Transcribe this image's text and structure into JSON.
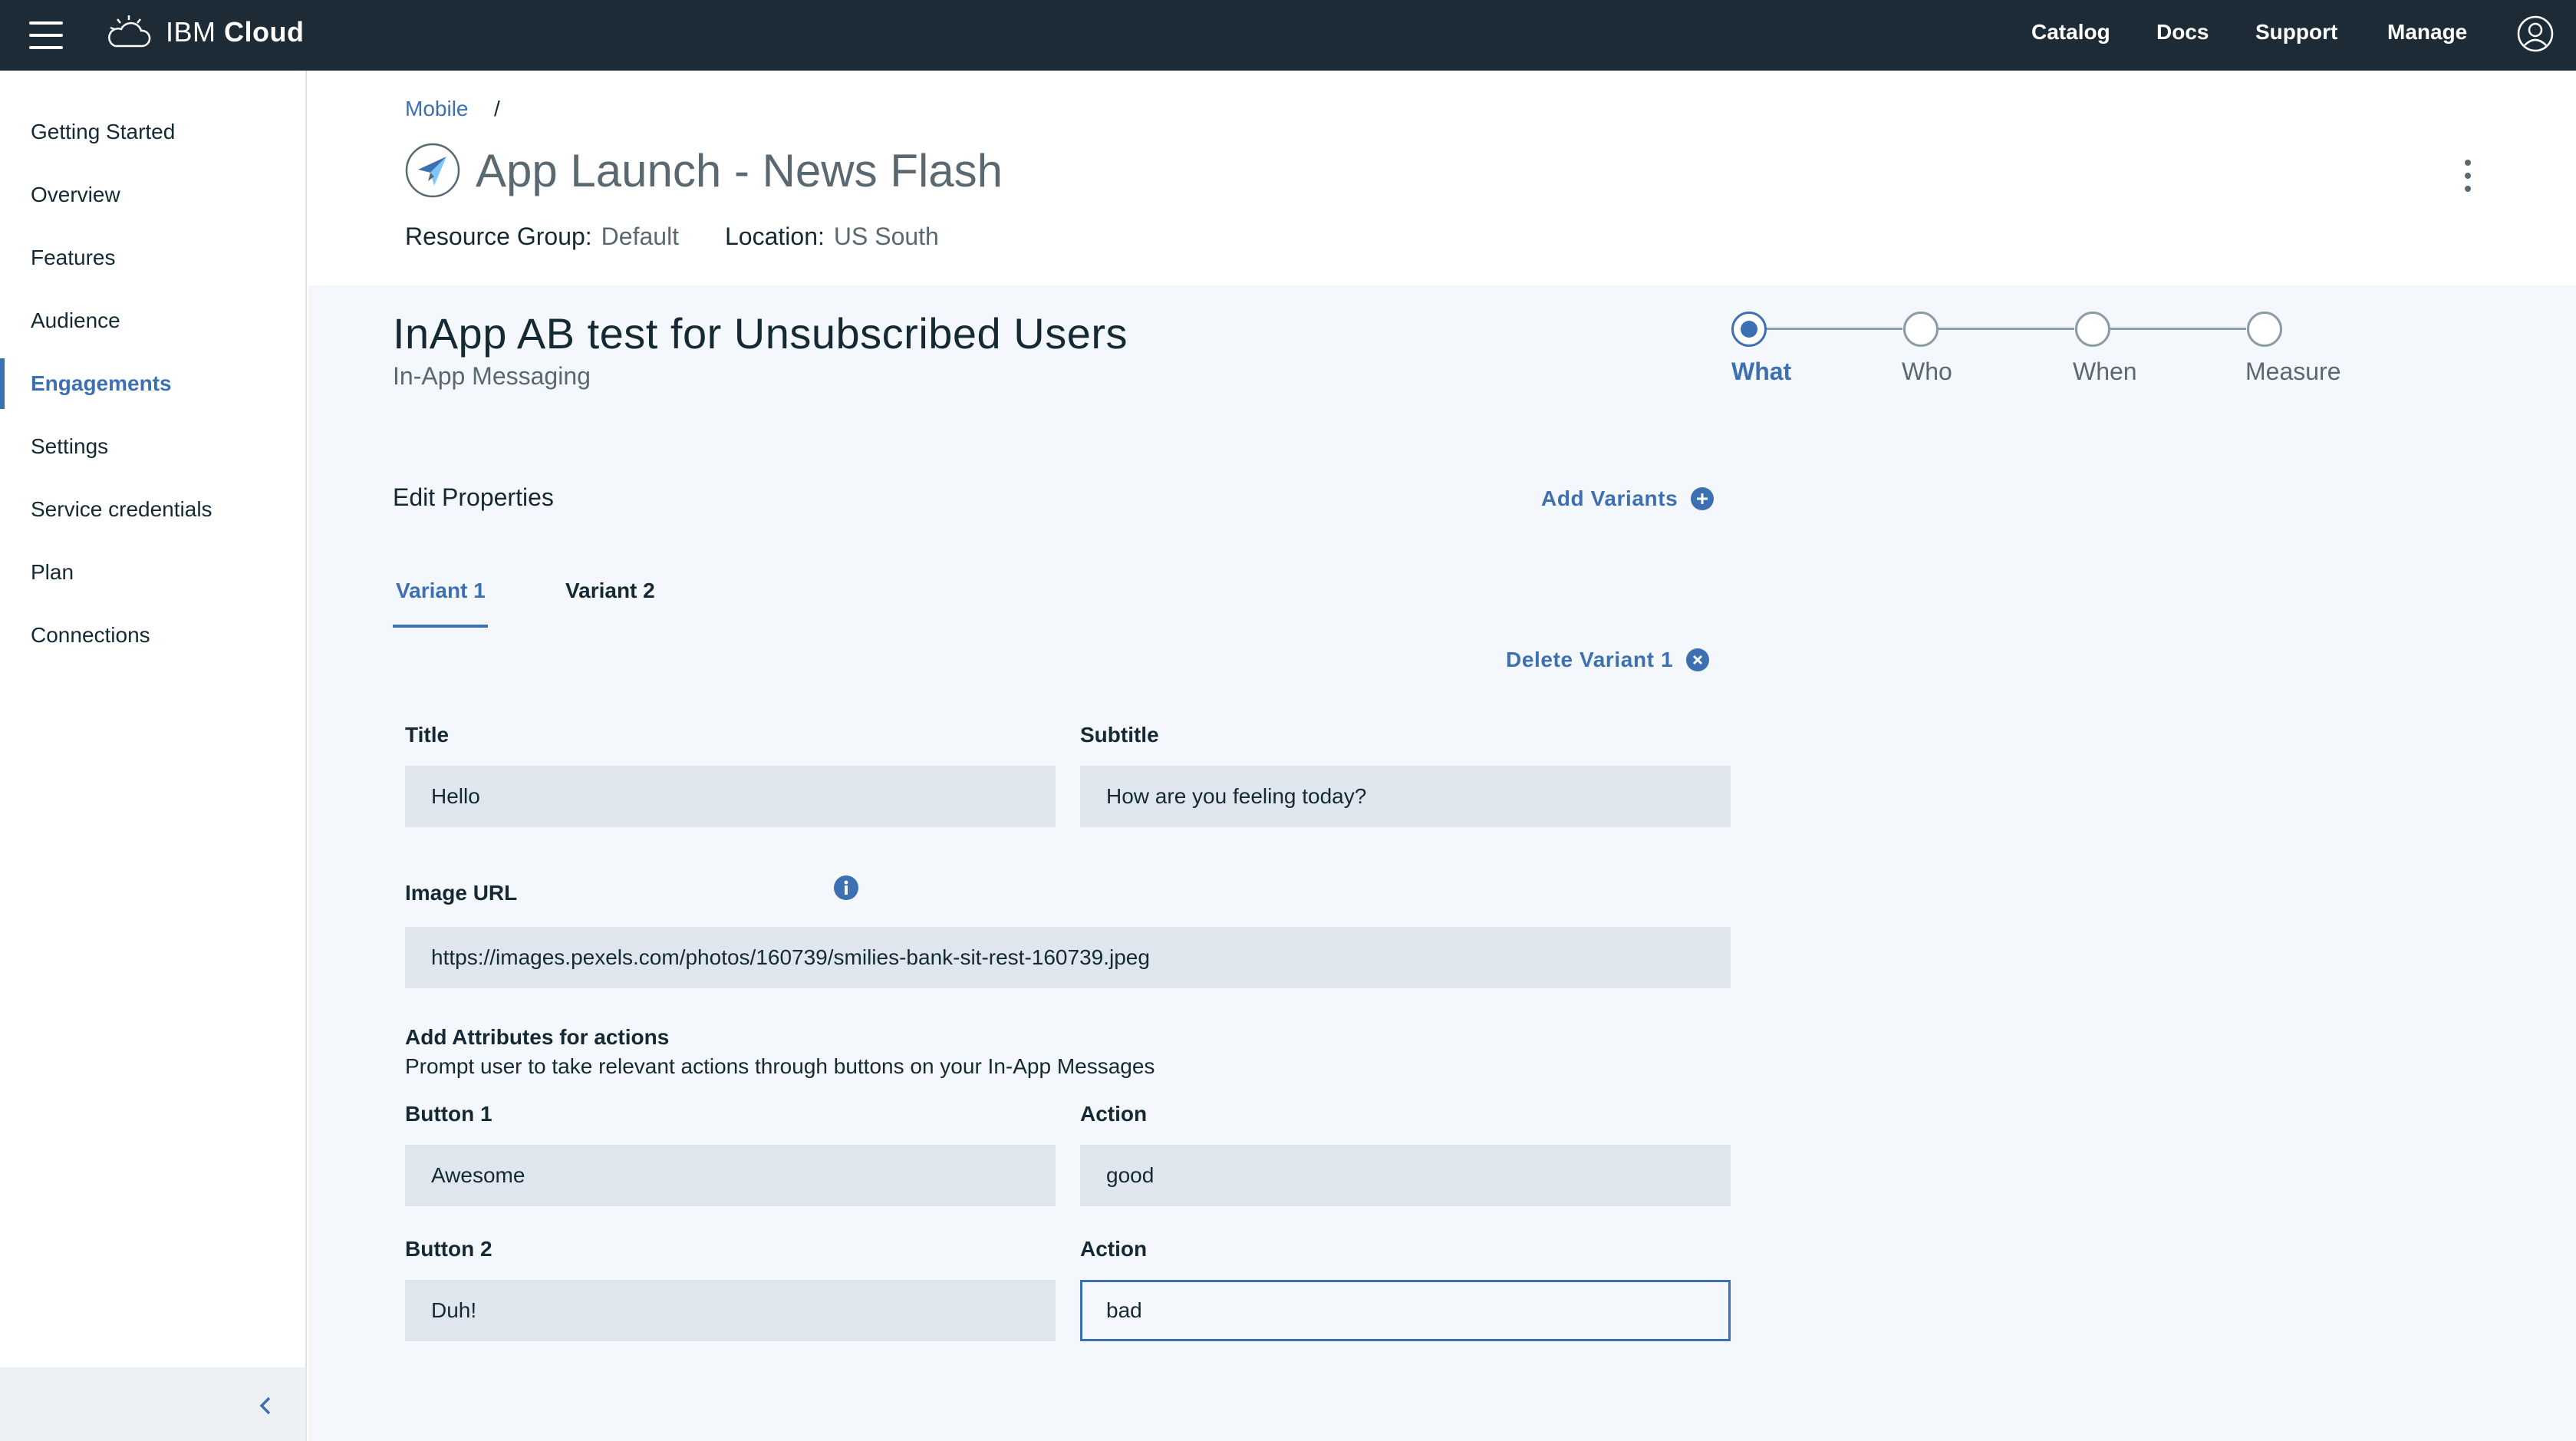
{
  "topbar": {
    "brand_prefix": "IBM",
    "brand_name": "Cloud",
    "nav": [
      "Catalog",
      "Docs",
      "Support",
      "Manage"
    ]
  },
  "sidebar": {
    "items": [
      {
        "label": "Getting Started"
      },
      {
        "label": "Overview"
      },
      {
        "label": "Features"
      },
      {
        "label": "Audience"
      },
      {
        "label": "Engagements",
        "active": true
      },
      {
        "label": "Settings"
      },
      {
        "label": "Service credentials"
      },
      {
        "label": "Plan"
      },
      {
        "label": "Connections"
      }
    ]
  },
  "header": {
    "breadcrumb": "Mobile",
    "breadcrumb_sep": "/",
    "title": "App Launch - News Flash",
    "resource_group_label": "Resource Group:",
    "resource_group_value": "Default",
    "location_label": "Location:",
    "location_value": "US South"
  },
  "engagement": {
    "title": "InApp AB test for Unsubscribed Users",
    "subtitle": "In-App Messaging",
    "steps": [
      {
        "label": "What",
        "active": true
      },
      {
        "label": "Who"
      },
      {
        "label": "When"
      },
      {
        "label": "Measure"
      }
    ],
    "edit_properties": "Edit Properties",
    "add_variants": "Add Variants",
    "tabs": [
      {
        "label": "Variant 1",
        "active": true
      },
      {
        "label": "Variant 2"
      }
    ],
    "delete_variant": "Delete Variant 1"
  },
  "form": {
    "title_label": "Title",
    "title_value": "Hello",
    "subtitle_label": "Subtitle",
    "subtitle_value": "How are you feeling today?",
    "image_url_label": "Image URL",
    "image_url_value": "https://images.pexels.com/photos/160739/smilies-bank-sit-rest-160739.jpeg",
    "attributes_heading": "Add Attributes for actions",
    "attributes_desc": "Prompt user to take relevant actions through buttons on your In-App Messages",
    "button1_label": "Button 1",
    "button1_value": "Awesome",
    "action1_label": "Action",
    "action1_value": "good",
    "button2_label": "Button 2",
    "button2_value": "Duh!",
    "action2_label": "Action",
    "action2_value": "bad"
  },
  "colors": {
    "topbar_bg": "#1d2b36",
    "accent": "#3d70b2",
    "field_bg": "#dfe6ee",
    "main_bg": "#f4f7fb"
  },
  "icons": {
    "menu": "hamburger-icon",
    "brand": "cloud-icon",
    "user": "user-icon",
    "app": "paper-plane-icon",
    "more": "kebab-icon",
    "add": "plus-circle-icon",
    "delete": "close-circle-icon",
    "info": "info-icon",
    "collapse": "chevron-left-icon"
  }
}
